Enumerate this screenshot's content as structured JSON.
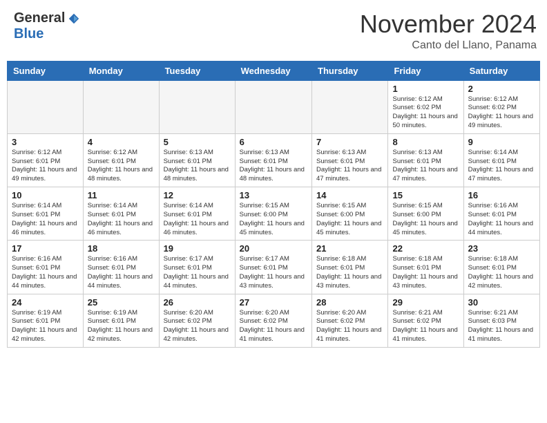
{
  "header": {
    "logo_general": "General",
    "logo_blue": "Blue",
    "month_title": "November 2024",
    "location": "Canto del Llano, Panama"
  },
  "weekdays": [
    "Sunday",
    "Monday",
    "Tuesday",
    "Wednesday",
    "Thursday",
    "Friday",
    "Saturday"
  ],
  "weeks": [
    [
      {
        "day": "",
        "empty": true
      },
      {
        "day": "",
        "empty": true
      },
      {
        "day": "",
        "empty": true
      },
      {
        "day": "",
        "empty": true
      },
      {
        "day": "",
        "empty": true
      },
      {
        "day": "1",
        "sunrise": "Sunrise: 6:12 AM",
        "sunset": "Sunset: 6:02 PM",
        "daylight": "Daylight: 11 hours and 50 minutes."
      },
      {
        "day": "2",
        "sunrise": "Sunrise: 6:12 AM",
        "sunset": "Sunset: 6:02 PM",
        "daylight": "Daylight: 11 hours and 49 minutes."
      }
    ],
    [
      {
        "day": "3",
        "sunrise": "Sunrise: 6:12 AM",
        "sunset": "Sunset: 6:01 PM",
        "daylight": "Daylight: 11 hours and 49 minutes."
      },
      {
        "day": "4",
        "sunrise": "Sunrise: 6:12 AM",
        "sunset": "Sunset: 6:01 PM",
        "daylight": "Daylight: 11 hours and 48 minutes."
      },
      {
        "day": "5",
        "sunrise": "Sunrise: 6:13 AM",
        "sunset": "Sunset: 6:01 PM",
        "daylight": "Daylight: 11 hours and 48 minutes."
      },
      {
        "day": "6",
        "sunrise": "Sunrise: 6:13 AM",
        "sunset": "Sunset: 6:01 PM",
        "daylight": "Daylight: 11 hours and 48 minutes."
      },
      {
        "day": "7",
        "sunrise": "Sunrise: 6:13 AM",
        "sunset": "Sunset: 6:01 PM",
        "daylight": "Daylight: 11 hours and 47 minutes."
      },
      {
        "day": "8",
        "sunrise": "Sunrise: 6:13 AM",
        "sunset": "Sunset: 6:01 PM",
        "daylight": "Daylight: 11 hours and 47 minutes."
      },
      {
        "day": "9",
        "sunrise": "Sunrise: 6:14 AM",
        "sunset": "Sunset: 6:01 PM",
        "daylight": "Daylight: 11 hours and 47 minutes."
      }
    ],
    [
      {
        "day": "10",
        "sunrise": "Sunrise: 6:14 AM",
        "sunset": "Sunset: 6:01 PM",
        "daylight": "Daylight: 11 hours and 46 minutes."
      },
      {
        "day": "11",
        "sunrise": "Sunrise: 6:14 AM",
        "sunset": "Sunset: 6:01 PM",
        "daylight": "Daylight: 11 hours and 46 minutes."
      },
      {
        "day": "12",
        "sunrise": "Sunrise: 6:14 AM",
        "sunset": "Sunset: 6:01 PM",
        "daylight": "Daylight: 11 hours and 46 minutes."
      },
      {
        "day": "13",
        "sunrise": "Sunrise: 6:15 AM",
        "sunset": "Sunset: 6:00 PM",
        "daylight": "Daylight: 11 hours and 45 minutes."
      },
      {
        "day": "14",
        "sunrise": "Sunrise: 6:15 AM",
        "sunset": "Sunset: 6:00 PM",
        "daylight": "Daylight: 11 hours and 45 minutes."
      },
      {
        "day": "15",
        "sunrise": "Sunrise: 6:15 AM",
        "sunset": "Sunset: 6:00 PM",
        "daylight": "Daylight: 11 hours and 45 minutes."
      },
      {
        "day": "16",
        "sunrise": "Sunrise: 6:16 AM",
        "sunset": "Sunset: 6:01 PM",
        "daylight": "Daylight: 11 hours and 44 minutes."
      }
    ],
    [
      {
        "day": "17",
        "sunrise": "Sunrise: 6:16 AM",
        "sunset": "Sunset: 6:01 PM",
        "daylight": "Daylight: 11 hours and 44 minutes."
      },
      {
        "day": "18",
        "sunrise": "Sunrise: 6:16 AM",
        "sunset": "Sunset: 6:01 PM",
        "daylight": "Daylight: 11 hours and 44 minutes."
      },
      {
        "day": "19",
        "sunrise": "Sunrise: 6:17 AM",
        "sunset": "Sunset: 6:01 PM",
        "daylight": "Daylight: 11 hours and 44 minutes."
      },
      {
        "day": "20",
        "sunrise": "Sunrise: 6:17 AM",
        "sunset": "Sunset: 6:01 PM",
        "daylight": "Daylight: 11 hours and 43 minutes."
      },
      {
        "day": "21",
        "sunrise": "Sunrise: 6:18 AM",
        "sunset": "Sunset: 6:01 PM",
        "daylight": "Daylight: 11 hours and 43 minutes."
      },
      {
        "day": "22",
        "sunrise": "Sunrise: 6:18 AM",
        "sunset": "Sunset: 6:01 PM",
        "daylight": "Daylight: 11 hours and 43 minutes."
      },
      {
        "day": "23",
        "sunrise": "Sunrise: 6:18 AM",
        "sunset": "Sunset: 6:01 PM",
        "daylight": "Daylight: 11 hours and 42 minutes."
      }
    ],
    [
      {
        "day": "24",
        "sunrise": "Sunrise: 6:19 AM",
        "sunset": "Sunset: 6:01 PM",
        "daylight": "Daylight: 11 hours and 42 minutes."
      },
      {
        "day": "25",
        "sunrise": "Sunrise: 6:19 AM",
        "sunset": "Sunset: 6:01 PM",
        "daylight": "Daylight: 11 hours and 42 minutes."
      },
      {
        "day": "26",
        "sunrise": "Sunrise: 6:20 AM",
        "sunset": "Sunset: 6:02 PM",
        "daylight": "Daylight: 11 hours and 42 minutes."
      },
      {
        "day": "27",
        "sunrise": "Sunrise: 6:20 AM",
        "sunset": "Sunset: 6:02 PM",
        "daylight": "Daylight: 11 hours and 41 minutes."
      },
      {
        "day": "28",
        "sunrise": "Sunrise: 6:20 AM",
        "sunset": "Sunset: 6:02 PM",
        "daylight": "Daylight: 11 hours and 41 minutes."
      },
      {
        "day": "29",
        "sunrise": "Sunrise: 6:21 AM",
        "sunset": "Sunset: 6:02 PM",
        "daylight": "Daylight: 11 hours and 41 minutes."
      },
      {
        "day": "30",
        "sunrise": "Sunrise: 6:21 AM",
        "sunset": "Sunset: 6:03 PM",
        "daylight": "Daylight: 11 hours and 41 minutes."
      }
    ]
  ]
}
